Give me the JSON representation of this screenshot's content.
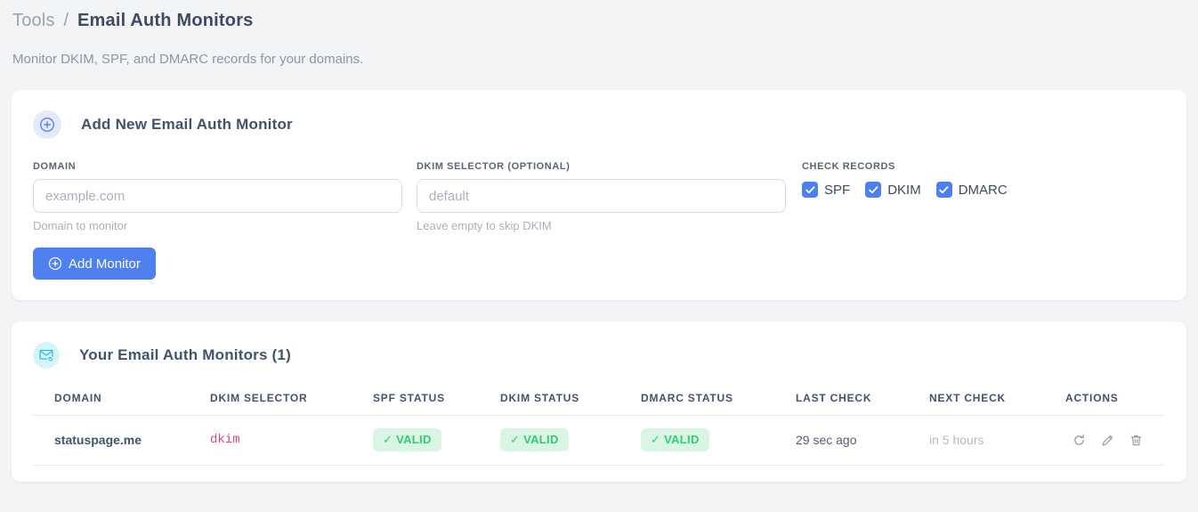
{
  "page": {
    "breadcrumb": {
      "section": "Tools",
      "separator": "/",
      "current": "Email Auth Monitors"
    },
    "subtitle": "Monitor DKIM, SPF, and DMARC records for your domains."
  },
  "add_card": {
    "title": "Add New Email Auth Monitor",
    "header_icon": "plus-circle-icon",
    "domain_field": {
      "label": "DOMAIN",
      "placeholder": "example.com",
      "value": "",
      "helper": "Domain to monitor"
    },
    "dkim_field": {
      "label": "DKIM SELECTOR (OPTIONAL)",
      "placeholder": "default",
      "value": "",
      "helper": "Leave empty to skip DKIM"
    },
    "check_records": {
      "label": "CHECK RECORDS",
      "options": [
        {
          "label": "SPF",
          "checked": true
        },
        {
          "label": "DKIM",
          "checked": true
        },
        {
          "label": "DMARC",
          "checked": true
        }
      ]
    },
    "submit_button": {
      "label": "Add Monitor",
      "icon": "plus-circle-icon"
    }
  },
  "monitors_card": {
    "title": "Your Email Auth Monitors (1)",
    "count": 1,
    "header_icon": "mail-check-icon",
    "table": {
      "headers": [
        "DOMAIN",
        "DKIM SELECTOR",
        "SPF STATUS",
        "DKIM STATUS",
        "DMARC STATUS",
        "LAST CHECK",
        "NEXT CHECK",
        "ACTIONS"
      ],
      "rows": [
        {
          "domain": "statuspage.me",
          "dkim_selector": "dkim",
          "spf_status": "✓ VALID",
          "dkim_status": "✓ VALID",
          "dmarc_status": "✓ VALID",
          "last_check": "29 sec ago",
          "next_check": "in 5 hours",
          "action_icons": [
            "refresh-icon",
            "edit-pencil-icon",
            "trash-icon"
          ]
        }
      ]
    }
  },
  "colors": {
    "accent_blue": "#4e80ee",
    "accent_cyan": "#29c0dc",
    "valid_green": "#2fcb77",
    "valid_green_bg": "#d9f6e5",
    "selector_pink": "#e5447e",
    "page_background": "#f3f4f6"
  }
}
